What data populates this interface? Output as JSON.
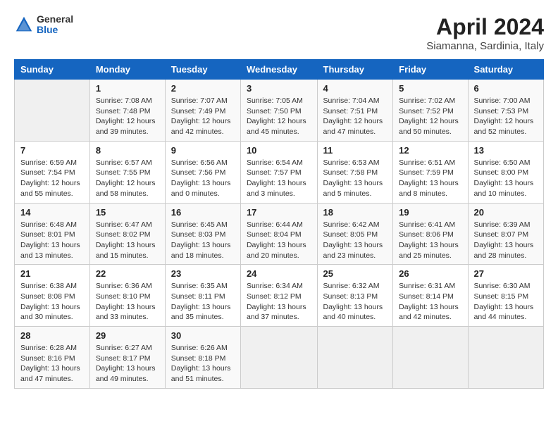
{
  "header": {
    "logo_general": "General",
    "logo_blue": "Blue",
    "title": "April 2024",
    "location": "Siamanna, Sardinia, Italy"
  },
  "days_of_week": [
    "Sunday",
    "Monday",
    "Tuesday",
    "Wednesday",
    "Thursday",
    "Friday",
    "Saturday"
  ],
  "weeks": [
    [
      {
        "day": "",
        "empty": true
      },
      {
        "day": "1",
        "sunrise": "7:08 AM",
        "sunset": "7:48 PM",
        "daylight": "12 hours and 39 minutes."
      },
      {
        "day": "2",
        "sunrise": "7:07 AM",
        "sunset": "7:49 PM",
        "daylight": "12 hours and 42 minutes."
      },
      {
        "day": "3",
        "sunrise": "7:05 AM",
        "sunset": "7:50 PM",
        "daylight": "12 hours and 45 minutes."
      },
      {
        "day": "4",
        "sunrise": "7:04 AM",
        "sunset": "7:51 PM",
        "daylight": "12 hours and 47 minutes."
      },
      {
        "day": "5",
        "sunrise": "7:02 AM",
        "sunset": "7:52 PM",
        "daylight": "12 hours and 50 minutes."
      },
      {
        "day": "6",
        "sunrise": "7:00 AM",
        "sunset": "7:53 PM",
        "daylight": "12 hours and 52 minutes."
      }
    ],
    [
      {
        "day": "7",
        "sunrise": "6:59 AM",
        "sunset": "7:54 PM",
        "daylight": "12 hours and 55 minutes."
      },
      {
        "day": "8",
        "sunrise": "6:57 AM",
        "sunset": "7:55 PM",
        "daylight": "12 hours and 58 minutes."
      },
      {
        "day": "9",
        "sunrise": "6:56 AM",
        "sunset": "7:56 PM",
        "daylight": "13 hours and 0 minutes."
      },
      {
        "day": "10",
        "sunrise": "6:54 AM",
        "sunset": "7:57 PM",
        "daylight": "13 hours and 3 minutes."
      },
      {
        "day": "11",
        "sunrise": "6:53 AM",
        "sunset": "7:58 PM",
        "daylight": "13 hours and 5 minutes."
      },
      {
        "day": "12",
        "sunrise": "6:51 AM",
        "sunset": "7:59 PM",
        "daylight": "13 hours and 8 minutes."
      },
      {
        "day": "13",
        "sunrise": "6:50 AM",
        "sunset": "8:00 PM",
        "daylight": "13 hours and 10 minutes."
      }
    ],
    [
      {
        "day": "14",
        "sunrise": "6:48 AM",
        "sunset": "8:01 PM",
        "daylight": "13 hours and 13 minutes."
      },
      {
        "day": "15",
        "sunrise": "6:47 AM",
        "sunset": "8:02 PM",
        "daylight": "13 hours and 15 minutes."
      },
      {
        "day": "16",
        "sunrise": "6:45 AM",
        "sunset": "8:03 PM",
        "daylight": "13 hours and 18 minutes."
      },
      {
        "day": "17",
        "sunrise": "6:44 AM",
        "sunset": "8:04 PM",
        "daylight": "13 hours and 20 minutes."
      },
      {
        "day": "18",
        "sunrise": "6:42 AM",
        "sunset": "8:05 PM",
        "daylight": "13 hours and 23 minutes."
      },
      {
        "day": "19",
        "sunrise": "6:41 AM",
        "sunset": "8:06 PM",
        "daylight": "13 hours and 25 minutes."
      },
      {
        "day": "20",
        "sunrise": "6:39 AM",
        "sunset": "8:07 PM",
        "daylight": "13 hours and 28 minutes."
      }
    ],
    [
      {
        "day": "21",
        "sunrise": "6:38 AM",
        "sunset": "8:08 PM",
        "daylight": "13 hours and 30 minutes."
      },
      {
        "day": "22",
        "sunrise": "6:36 AM",
        "sunset": "8:10 PM",
        "daylight": "13 hours and 33 minutes."
      },
      {
        "day": "23",
        "sunrise": "6:35 AM",
        "sunset": "8:11 PM",
        "daylight": "13 hours and 35 minutes."
      },
      {
        "day": "24",
        "sunrise": "6:34 AM",
        "sunset": "8:12 PM",
        "daylight": "13 hours and 37 minutes."
      },
      {
        "day": "25",
        "sunrise": "6:32 AM",
        "sunset": "8:13 PM",
        "daylight": "13 hours and 40 minutes."
      },
      {
        "day": "26",
        "sunrise": "6:31 AM",
        "sunset": "8:14 PM",
        "daylight": "13 hours and 42 minutes."
      },
      {
        "day": "27",
        "sunrise": "6:30 AM",
        "sunset": "8:15 PM",
        "daylight": "13 hours and 44 minutes."
      }
    ],
    [
      {
        "day": "28",
        "sunrise": "6:28 AM",
        "sunset": "8:16 PM",
        "daylight": "13 hours and 47 minutes."
      },
      {
        "day": "29",
        "sunrise": "6:27 AM",
        "sunset": "8:17 PM",
        "daylight": "13 hours and 49 minutes."
      },
      {
        "day": "30",
        "sunrise": "6:26 AM",
        "sunset": "8:18 PM",
        "daylight": "13 hours and 51 minutes."
      },
      {
        "day": "",
        "empty": true
      },
      {
        "day": "",
        "empty": true
      },
      {
        "day": "",
        "empty": true
      },
      {
        "day": "",
        "empty": true
      }
    ]
  ],
  "labels": {
    "sunrise": "Sunrise: ",
    "sunset": "Sunset: ",
    "daylight": "Daylight: "
  }
}
